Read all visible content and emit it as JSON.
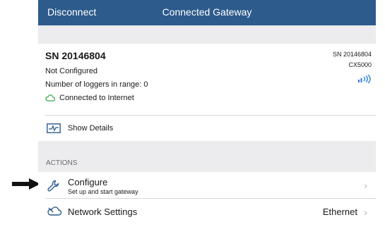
{
  "navbar": {
    "left_button": "Disconnect",
    "title": "Connected Gateway"
  },
  "device": {
    "title": "SN 20146804",
    "status": "Not Configured",
    "loggers": "Number of loggers in range: 0",
    "internet": "Connected to Internet",
    "serial": "SN 20146804",
    "model": "CX5000"
  },
  "details": {
    "label": "Show Details"
  },
  "actions": {
    "header": "ACTIONS",
    "items": [
      {
        "title": "Configure",
        "subtitle": "Set up and start gateway",
        "icon": "wrench-icon"
      },
      {
        "title": "Network Settings",
        "value": "Ethernet",
        "icon": "cloud-icon"
      }
    ]
  },
  "colors": {
    "navbar": "#2d5b8c",
    "accent": "#2d7ad6",
    "cloud": "#3aa84a",
    "band": "#ececee"
  }
}
